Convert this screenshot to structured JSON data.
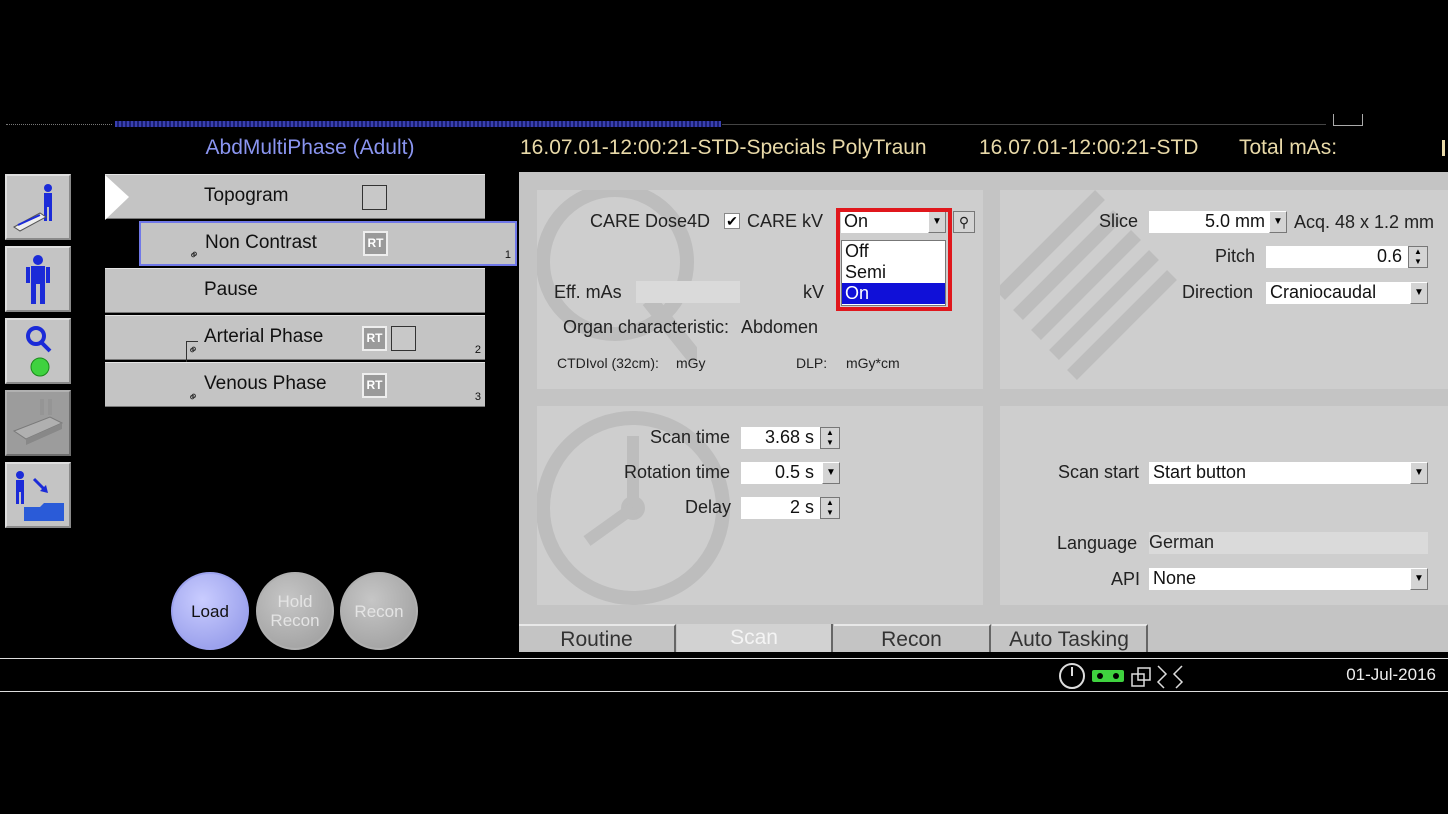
{
  "header": {
    "protocol_title": "AbdMultiPhase (Adult)",
    "series_1": "16.07.01-12:00:21-STD-Specials PolyTraun",
    "series_2": "16.07.01-12:00:21-STD",
    "total_mas": "Total mAs:"
  },
  "protocol_list": [
    {
      "label": "Topogram",
      "number": ""
    },
    {
      "label": "Non Contrast",
      "badge": "RT",
      "number": "1"
    },
    {
      "label": "Pause",
      "number": ""
    },
    {
      "label": "Arterial Phase",
      "badge": "RT",
      "number": "2"
    },
    {
      "label": "Venous Phase",
      "badge": "RT",
      "number": "3"
    }
  ],
  "actions": {
    "load": "Load",
    "hold_recon": "Hold Recon",
    "recon": "Recon"
  },
  "dose": {
    "care_dose_label": "CARE Dose4D",
    "care_dose_checked": true,
    "care_kv_label": "CARE kV",
    "care_kv_value": "On",
    "care_kv_options": [
      "Off",
      "Semi",
      "On"
    ],
    "eff_mas_label": "Eff. mAs",
    "eff_mas_value": "",
    "kv_label": "kV",
    "organ_label": "Organ characteristic:",
    "organ_value": "Abdomen",
    "ctdi_label": "CTDIvol (32cm):",
    "ctdi_unit": "mGy",
    "dlp_label": "DLP:",
    "dlp_unit": "mGy*cm"
  },
  "geometry": {
    "slice_label": "Slice",
    "slice_value": "5.0 mm",
    "acq_text": "Acq. 48 x 1.2 mm",
    "pitch_label": "Pitch",
    "pitch_value": "0.6",
    "direction_label": "Direction",
    "direction_value": "Craniocaudal"
  },
  "timing": {
    "scan_time_label": "Scan time",
    "scan_time_value": "3.68 s",
    "rotation_label": "Rotation time",
    "rotation_value": "0.5 s",
    "delay_label": "Delay",
    "delay_value": "2 s"
  },
  "scan_options": {
    "scan_start_label": "Scan start",
    "scan_start_value": "Start button",
    "language_label": "Language",
    "language_value": "German",
    "api_label": "API",
    "api_value": "None"
  },
  "tabs": [
    "Routine",
    "Scan",
    "Recon",
    "Auto Tasking"
  ],
  "active_tab": "Scan",
  "status": {
    "date": "01-Jul-2016"
  },
  "colors": {
    "header_title": "#8a95f0",
    "header_text": "#e8d9a8",
    "highlight_box": "#e0171c",
    "selected_option": "#1010d8"
  }
}
